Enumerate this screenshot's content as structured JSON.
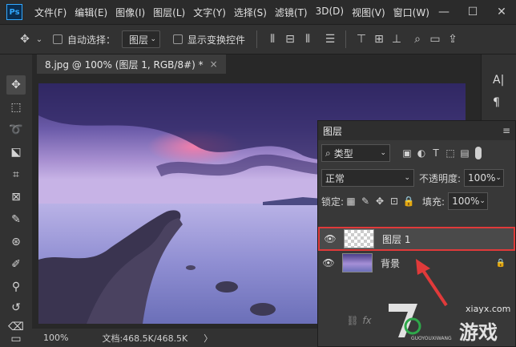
{
  "menubar": {
    "logo": "Ps",
    "items": [
      "文件(F)",
      "编辑(E)",
      "图像(I)",
      "图层(L)",
      "文字(Y)",
      "选择(S)",
      "滤镜(T)",
      "3D(D)",
      "视图(V)",
      "窗口(W)"
    ],
    "window_controls": [
      "—",
      "☐",
      "✕"
    ]
  },
  "options": {
    "auto_select_label": "自动选择：",
    "auto_select_value": "图层",
    "show_transform_label": "显示变换控件"
  },
  "document": {
    "tab_title": "8.jpg @ 100% (图层 1, RGB/8#) *",
    "close": "×"
  },
  "status": {
    "zoom": "100%",
    "doc_info": "文档:468.5K/468.5K",
    "arrow": "〉"
  },
  "layers_panel": {
    "title": "图层",
    "filter_kind": "类型",
    "blend_mode": "正常",
    "opacity_label": "不透明度:",
    "opacity_value": "100%",
    "lock_label": "锁定:",
    "fill_label": "填充:",
    "fill_value": "100%",
    "layers": [
      {
        "name": "图层 1",
        "selected": true
      },
      {
        "name": "背景",
        "selected": false,
        "locked": true
      }
    ]
  },
  "watermark": {
    "url": "xiayx.com",
    "brand": "游戏",
    "sub": "GUOYOUXIWANG"
  },
  "colors": {
    "accent": "#31a8ff",
    "highlight": "#e03a3a"
  }
}
